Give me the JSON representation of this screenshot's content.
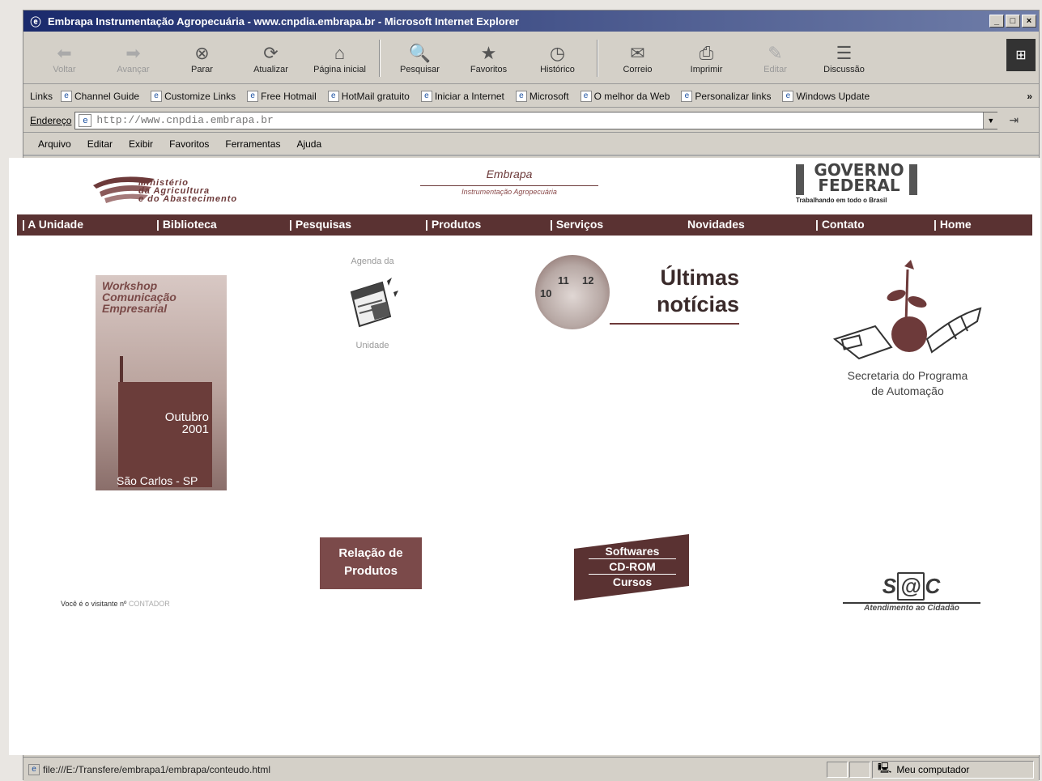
{
  "window": {
    "title": "Embrapa Instrumentação Agropecuária - www.cnpdia.embrapa.br - Microsoft Internet Explorer",
    "controls": [
      "_",
      "□",
      "×"
    ]
  },
  "toolbar": {
    "buttons": [
      {
        "label": "Voltar",
        "icon": "back-arrow-icon",
        "glyph": "⬅"
      },
      {
        "label": "Avançar",
        "icon": "forward-arrow-icon",
        "glyph": "➡"
      },
      {
        "label": "Parar",
        "icon": "stop-icon",
        "glyph": "⊗"
      },
      {
        "label": "Atualizar",
        "icon": "refresh-icon",
        "glyph": "⟳"
      },
      {
        "label": "Página inicial",
        "icon": "home-icon",
        "glyph": "⌂"
      },
      {
        "label": "Pesquisar",
        "icon": "search-icon",
        "glyph": "🔍"
      },
      {
        "label": "Favoritos",
        "icon": "favorites-icon",
        "glyph": "★"
      },
      {
        "label": "Histórico",
        "icon": "history-icon",
        "glyph": "◷"
      },
      {
        "label": "Correio",
        "icon": "mail-icon",
        "glyph": "✉"
      },
      {
        "label": "Imprimir",
        "icon": "print-icon",
        "glyph": "⎙"
      },
      {
        "label": "Editar",
        "icon": "edit-icon",
        "glyph": "✎"
      },
      {
        "label": "Discussão",
        "icon": "discussion-icon",
        "glyph": "☰"
      }
    ]
  },
  "links_bar": {
    "label": "Links",
    "items": [
      "Channel Guide",
      "Customize Links",
      "Free Hotmail",
      "HotMail gratuito",
      "Iniciar a Internet",
      "Microsoft",
      "O melhor da Web",
      "Personalizar links",
      "Windows Update"
    ],
    "more": "»"
  },
  "address_bar": {
    "label": "Endereço",
    "url": "http://www.cnpdia.embrapa.br",
    "go": "⇥"
  },
  "menu_bar": {
    "items": [
      "Arquivo",
      "Editar",
      "Exibir",
      "Favoritos",
      "Ferramentas",
      "Ajuda"
    ]
  },
  "header": {
    "ministerio": "Ministério da Agricultura e do Abastecimento",
    "ministerio_lines": [
      "Ministério",
      "da Agricultura",
      "e do Abastecimento"
    ],
    "embrapa_name": "Embrapa",
    "embrapa_sub": "Instrumentação Agropecuária",
    "governo_lines": [
      "GOVERNO",
      "FEDERAL"
    ],
    "governo_sub": "Trabalhando em todo o Brasil"
  },
  "nav": {
    "items": [
      "A Unidade",
      "Biblioteca",
      "Pesquisas",
      "Produtos",
      "Serviços",
      "Novidades",
      "Contato",
      "Home"
    ]
  },
  "content": {
    "workshop": {
      "title_lines": [
        "Workshop",
        "Comunicação",
        "Empresarial"
      ],
      "date_lines": [
        "Outubro",
        "2001"
      ],
      "city": "São Carlos - SP"
    },
    "agenda": {
      "top": "Agenda da",
      "bottom": "Unidade"
    },
    "noticias": {
      "lines": [
        "Últimas",
        "notícias"
      ],
      "clock_numbers": [
        "10",
        "11",
        "12"
      ]
    },
    "secretaria": {
      "lines": [
        "Secretaria do Programa",
        "de Automação"
      ]
    },
    "relacao": {
      "lines": [
        "Relação de",
        "Produtos"
      ]
    },
    "softwares": {
      "lines": [
        "Softwares",
        "CD-ROM",
        "Cursos"
      ]
    },
    "visitante": {
      "text": "Você é o visitante nº",
      "counter": "CONTADOR"
    },
    "sac": {
      "logo_s": "S",
      "logo_at": "@",
      "logo_c": "C",
      "sub": "Atendimento ao Cidadão"
    }
  },
  "status_bar": {
    "url": "file:///E:/Transfere/embrapa1/embrapa/conteudo.html",
    "zone": "Meu computador"
  },
  "colors": {
    "titlebar_start": "#1a2a6c",
    "nav_bg": "#5a3232",
    "brand_maroon": "#7b4a4a"
  }
}
